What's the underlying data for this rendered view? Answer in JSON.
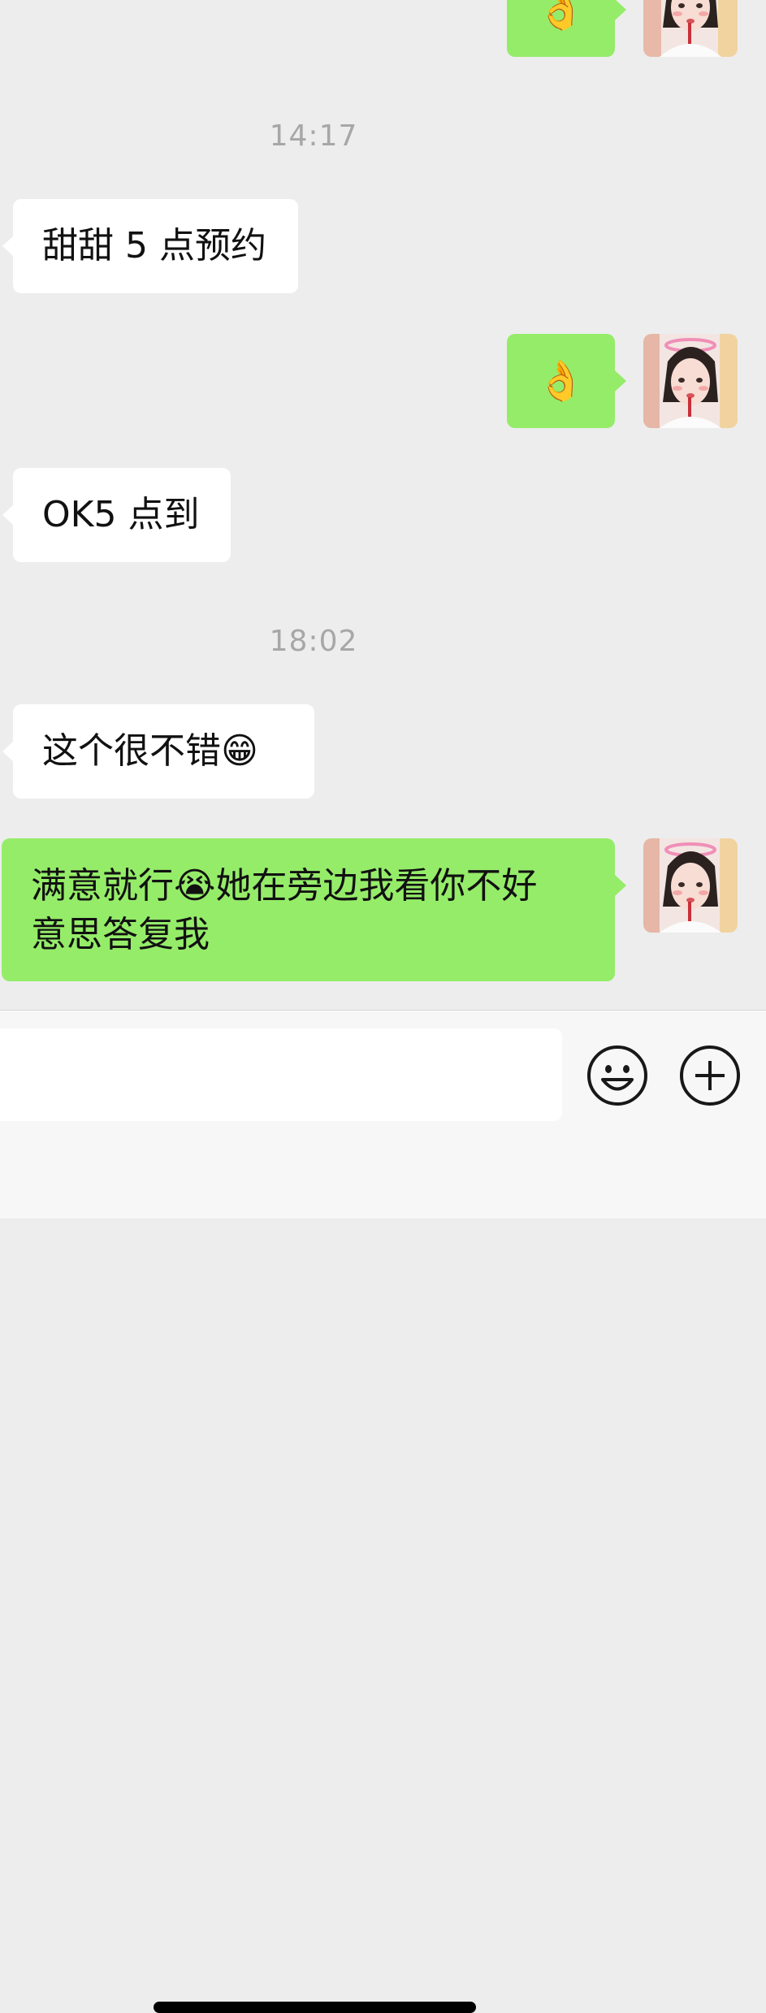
{
  "chat": {
    "top_sent_message": {
      "text": "👌"
    },
    "timestamp_1": "14:17",
    "received_1": {
      "text": "甜甜 5 点预约"
    },
    "sent_1": {
      "text": "👌"
    },
    "received_2": {
      "text": "OK5 点到"
    },
    "timestamp_2": "18:02",
    "received_3": {
      "text": "这个很不错😁"
    },
    "sent_2": {
      "line1": "满意就行😭她在旁边我看你不好",
      "line2": "意思答复我"
    }
  },
  "input_bar": {
    "input_value": "",
    "emoji_button_icon": "smiley-face-icon",
    "plus_button_icon": "plus-circle-icon"
  },
  "colors": {
    "background": "#ededed",
    "sent_bubble": "#95ec69",
    "received_bubble": "#ffffff",
    "timestamp": "#a7a7a7"
  }
}
